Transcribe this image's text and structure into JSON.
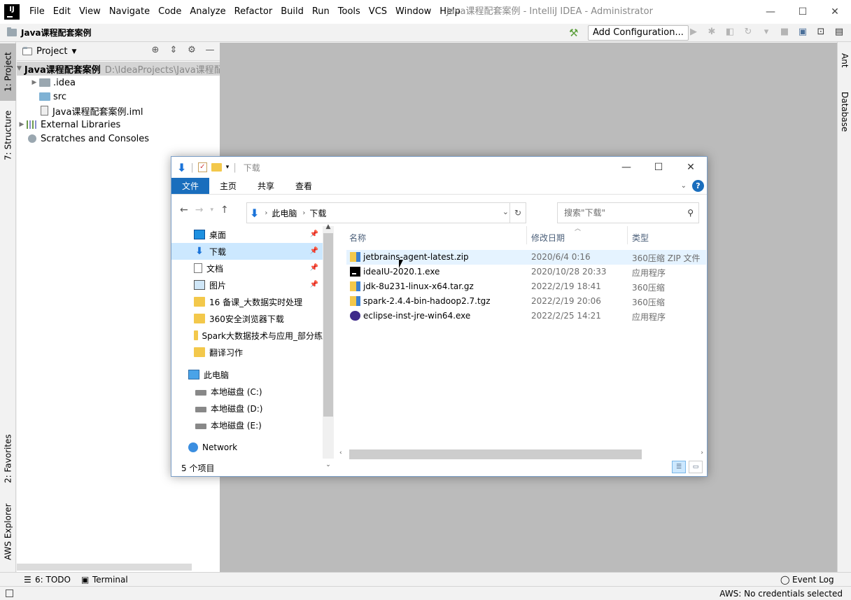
{
  "app": {
    "logo_text": "IJ",
    "window_title": "Java课程配套案例 - IntelliJ IDEA - Administrator",
    "menu": [
      "File",
      "Edit",
      "View",
      "Navigate",
      "Code",
      "Analyze",
      "Refactor",
      "Build",
      "Run",
      "Tools",
      "VCS",
      "Window",
      "Help"
    ],
    "win_buttons": {
      "minimize": "—",
      "maximize": "☐",
      "close": "✕"
    }
  },
  "navbar": {
    "project_name": "Java课程配套案例",
    "add_configuration": "Add Configuration...",
    "toolbar_icons": [
      "▶",
      "✱",
      "◧",
      "↻",
      "▾",
      "■",
      "▣",
      "⊡",
      "▤"
    ]
  },
  "left_tabs": {
    "project": "1: Project",
    "structure": "7: Structure",
    "favorites": "2: Favorites",
    "aws_explorer": "AWS Explorer"
  },
  "right_tabs": {
    "ant": "Ant",
    "database": "Database"
  },
  "project_panel": {
    "title": "Project",
    "tools": [
      "⊕",
      "⇕",
      "⚙",
      "—"
    ],
    "tree": [
      {
        "label": "Java课程配套案例",
        "path": "D:\\IdeaProjects\\Java课程配",
        "kind": "folder",
        "depth": 0,
        "expanded": true,
        "bold": true
      },
      {
        "label": ".idea",
        "kind": "folder",
        "depth": 1,
        "expanded": false
      },
      {
        "label": "src",
        "kind": "folder-src",
        "depth": 1
      },
      {
        "label": "Java课程配套案例.iml",
        "kind": "iml",
        "depth": 1
      },
      {
        "label": "External Libraries",
        "kind": "libs",
        "depth": 0,
        "expanded": false
      },
      {
        "label": "Scratches and Consoles",
        "kind": "scratch",
        "depth": 0
      }
    ]
  },
  "bottom_tools": {
    "todo": "6: TODO",
    "terminal": "Terminal",
    "event_log": "Event Log"
  },
  "status": {
    "aws": "AWS: No credentials selected"
  },
  "explorer": {
    "title": "下载",
    "ribbon": {
      "file": "文件",
      "home": "主页",
      "share": "共享",
      "view": "查看",
      "help": "?"
    },
    "breadcrumb": [
      "此电脑",
      "下载"
    ],
    "search_placeholder": "搜索\"下载\"",
    "nav_items": [
      {
        "label": "桌面",
        "icon": "desktop",
        "pinned": true
      },
      {
        "label": "下载",
        "icon": "download",
        "pinned": true,
        "selected": true
      },
      {
        "label": "文档",
        "icon": "document",
        "pinned": true
      },
      {
        "label": "图片",
        "icon": "picture",
        "pinned": true
      },
      {
        "label": "16 备课_大数据实时处理",
        "icon": "folder"
      },
      {
        "label": "360安全浏览器下载",
        "icon": "folder"
      },
      {
        "label": "Spark大数据技术与应用_部分练",
        "icon": "folder"
      },
      {
        "label": "翻译习作",
        "icon": "folder"
      }
    ],
    "this_pc": "此电脑",
    "drives": [
      "本地磁盘 (C:)",
      "本地磁盘 (D:)",
      "本地磁盘 (E:)"
    ],
    "network": "Network",
    "columns": {
      "name": "名称",
      "date": "修改日期",
      "type": "类型"
    },
    "files": [
      {
        "name": "jetbrains-agent-latest.zip",
        "date": "2020/6/4 0:16",
        "type": "360压缩 ZIP 文件",
        "icon": "zip"
      },
      {
        "name": "ideaIU-2020.1.exe",
        "date": "2020/10/28 20:33",
        "type": "应用程序",
        "icon": "exe-ij"
      },
      {
        "name": "jdk-8u231-linux-x64.tar.gz",
        "date": "2022/2/19 18:41",
        "type": "360压缩",
        "icon": "zip"
      },
      {
        "name": "spark-2.4.4-bin-hadoop2.7.tgz",
        "date": "2022/2/19 20:06",
        "type": "360压缩",
        "icon": "zip"
      },
      {
        "name": "eclipse-inst-jre-win64.exe",
        "date": "2022/2/25 14:21",
        "type": "应用程序",
        "icon": "eclipse"
      }
    ],
    "item_count": "5 个项目"
  }
}
